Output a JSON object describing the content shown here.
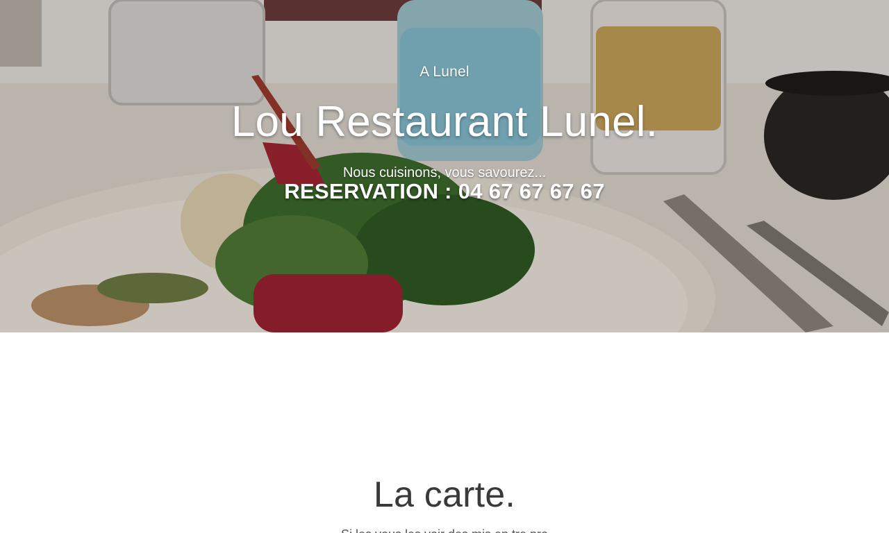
{
  "hero": {
    "kicker": "A Lunel",
    "title": "Lou Restaurant Lunel.",
    "tagline": "Nous cuisinons, vous savourez...",
    "reservation": "RESERVATION  : 04 67 67 67 67"
  },
  "carte": {
    "title": "La carte.",
    "subtitle": "Si les vous les voir des mis en tre pro"
  },
  "colors": {
    "hero_text": "#ffffff",
    "heading_dark": "#3a3a3a",
    "page_bg": "#ffffff"
  }
}
